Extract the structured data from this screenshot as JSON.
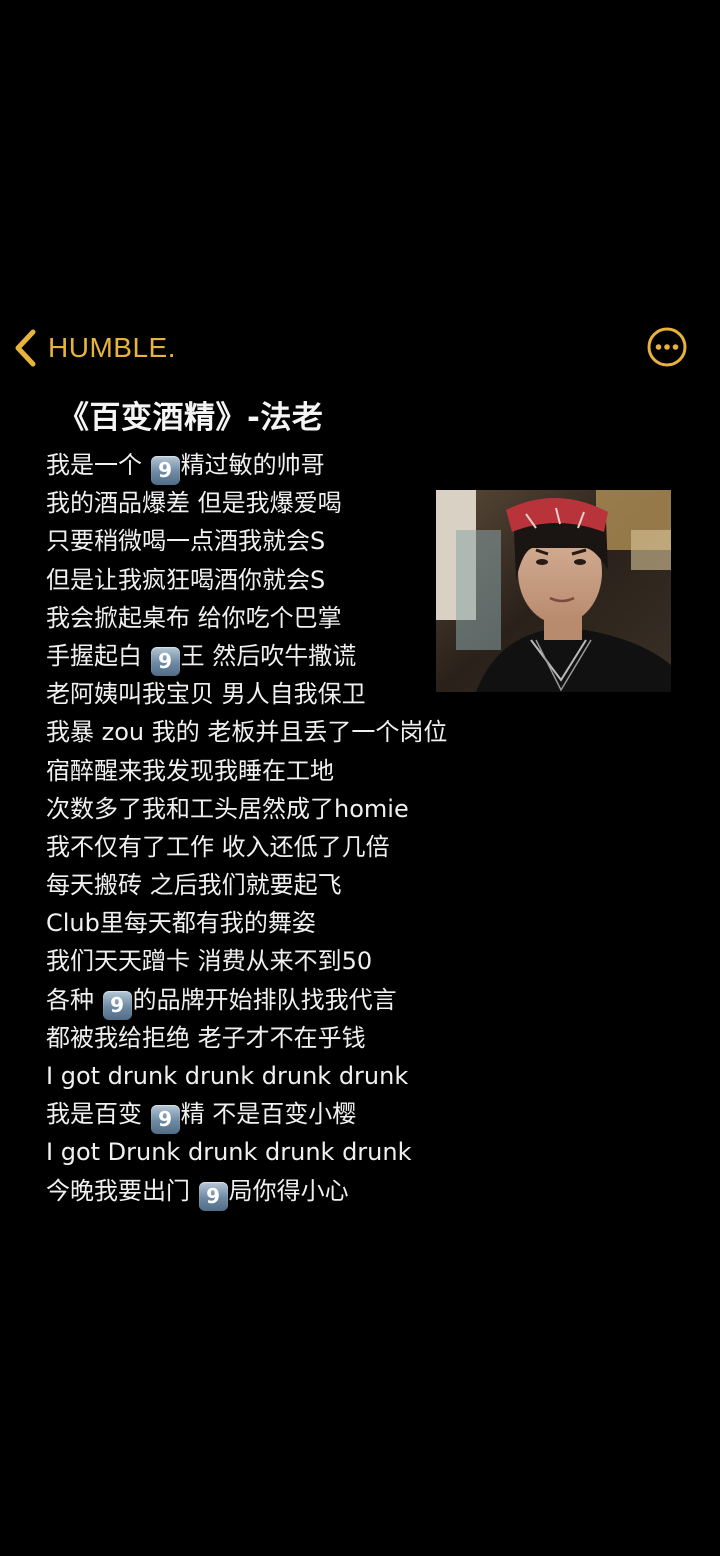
{
  "header": {
    "back_label": "HUMBLE.",
    "accent_color": "#e8b33a",
    "back_icon": "chevron-left-icon",
    "more_icon": "ellipsis-circle-icon"
  },
  "note": {
    "title": "《百变酒精》-法老",
    "image": "portrait-photo-man-with-red-bandana",
    "lines": [
      [
        "我是一个 ",
        "9",
        "精过敏的帅哥"
      ],
      [
        "我的酒品爆差 但是我爆爱喝"
      ],
      [
        "只要稍微喝一点酒我就会S"
      ],
      [
        "但是让我疯狂喝酒你就会S"
      ],
      [
        "我会掀起桌布 给你吃个巴掌"
      ],
      [
        "手握起白 ",
        "9",
        "王 然后吹牛撒谎"
      ],
      [
        "老阿姨叫我宝贝 男人自我保卫"
      ],
      [
        "我暴 zou 我的 老板并且丢了一个岗位"
      ],
      [
        "宿醉醒来我发现我睡在工地"
      ],
      [
        "次数多了我和工头居然成了homie"
      ],
      [
        "我不仅有了工作 收入还低了几倍"
      ],
      [
        "每天搬砖 之后我们就要起飞"
      ],
      [
        "Club里每天都有我的舞姿"
      ],
      [
        "我们天天蹭卡 消费从来不到50"
      ],
      [
        "各种 ",
        "9",
        "的品牌开始排队找我代言"
      ],
      [
        "都被我给拒绝 老子才不在乎钱"
      ],
      [
        "I got drunk drunk drunk drunk"
      ],
      [
        "我是百变 ",
        "9",
        "精 不是百变小樱"
      ],
      [
        "I got Drunk drunk drunk drunk"
      ],
      [
        "今晚我要出门 ",
        "9",
        "局你得小心"
      ]
    ]
  }
}
